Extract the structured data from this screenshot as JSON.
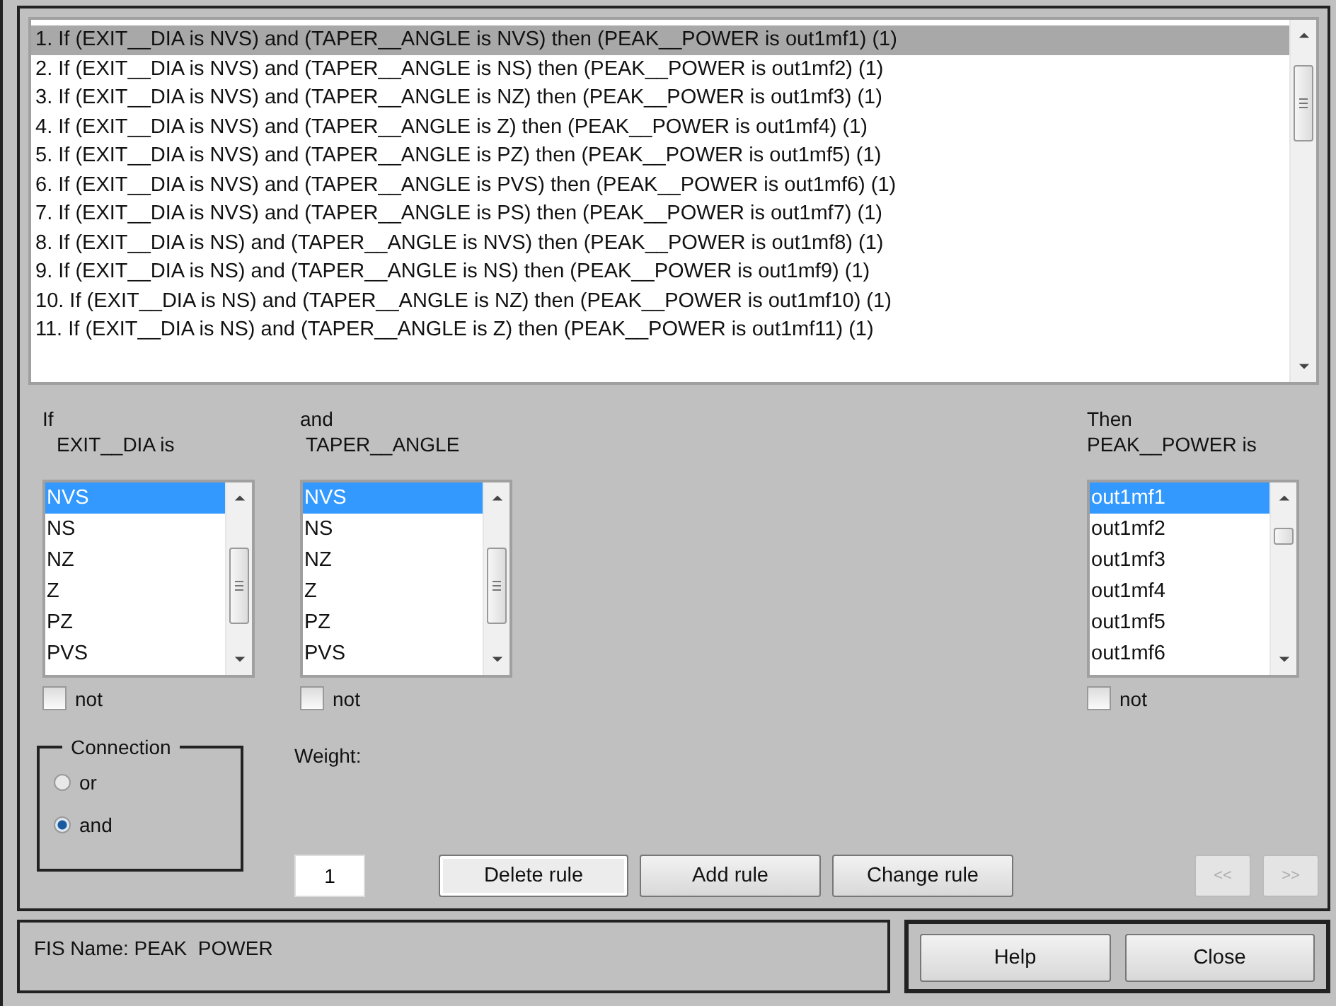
{
  "rules": [
    {
      "text": "1. If (EXIT__DIA is NVS) and (TAPER__ANGLE is NVS) then (PEAK__POWER is out1mf1) (1)",
      "selected": true
    },
    {
      "text": "2. If (EXIT__DIA is NVS) and (TAPER__ANGLE is NS) then (PEAK__POWER is out1mf2) (1)",
      "selected": false
    },
    {
      "text": "3. If (EXIT__DIA is NVS) and (TAPER__ANGLE is NZ) then (PEAK__POWER is out1mf3) (1)",
      "selected": false
    },
    {
      "text": "4. If (EXIT__DIA is NVS) and (TAPER__ANGLE is Z) then (PEAK__POWER is out1mf4) (1)",
      "selected": false
    },
    {
      "text": "5. If (EXIT__DIA is NVS) and (TAPER__ANGLE is PZ) then (PEAK__POWER is out1mf5) (1)",
      "selected": false
    },
    {
      "text": "6. If (EXIT__DIA is NVS) and (TAPER__ANGLE is PVS) then (PEAK__POWER is out1mf6) (1)",
      "selected": false
    },
    {
      "text": "7. If (EXIT__DIA is NVS) and (TAPER__ANGLE is PS) then (PEAK__POWER is out1mf7) (1)",
      "selected": false
    },
    {
      "text": "8. If (EXIT__DIA is NS) and (TAPER__ANGLE is NVS) then (PEAK__POWER is out1mf8) (1)",
      "selected": false
    },
    {
      "text": "9. If (EXIT__DIA is NS) and (TAPER__ANGLE is NS) then (PEAK__POWER is out1mf9) (1)",
      "selected": false
    },
    {
      "text": "10. If (EXIT__DIA is NS) and (TAPER__ANGLE is NZ) then (PEAK__POWER is out1mf10) (1)",
      "selected": false
    },
    {
      "text": "11. If (EXIT__DIA is NS) and (TAPER__ANGLE is Z) then (PEAK__POWER is out1mf11) (1)",
      "selected": false
    }
  ],
  "selectors": [
    {
      "caption": "If",
      "variable": "EXIT__DIA is",
      "items": [
        {
          "label": "NVS",
          "selected": true
        },
        {
          "label": "NS",
          "selected": false
        },
        {
          "label": "NZ",
          "selected": false
        },
        {
          "label": "Z",
          "selected": false
        },
        {
          "label": "PZ",
          "selected": false
        },
        {
          "label": "PVS",
          "selected": false
        }
      ],
      "not_label": "not",
      "not_checked": false
    },
    {
      "caption": "and",
      "variable": "TAPER__ANGLE",
      "items": [
        {
          "label": "NVS",
          "selected": true
        },
        {
          "label": "NS",
          "selected": false
        },
        {
          "label": "NZ",
          "selected": false
        },
        {
          "label": "Z",
          "selected": false
        },
        {
          "label": "PZ",
          "selected": false
        },
        {
          "label": "PVS",
          "selected": false
        }
      ],
      "not_label": "not",
      "not_checked": false
    },
    {
      "caption": "Then",
      "variable": "PEAK__POWER is",
      "items": [
        {
          "label": "out1mf1",
          "selected": true
        },
        {
          "label": "out1mf2",
          "selected": false
        },
        {
          "label": "out1mf3",
          "selected": false
        },
        {
          "label": "out1mf4",
          "selected": false
        },
        {
          "label": "out1mf5",
          "selected": false
        },
        {
          "label": "out1mf6",
          "selected": false
        }
      ],
      "not_label": "not",
      "not_checked": false
    }
  ],
  "connection": {
    "title": "Connection",
    "options": [
      {
        "label": "or",
        "selected": false
      },
      {
        "label": "and",
        "selected": true
      }
    ]
  },
  "weight": {
    "label": "Weight:",
    "value": "1"
  },
  "actions": [
    {
      "label": "Delete rule",
      "disabled": false
    },
    {
      "label": "Add rule",
      "disabled": false
    },
    {
      "label": "Change rule",
      "disabled": false
    }
  ],
  "nav": [
    {
      "label": "<<",
      "disabled": true
    },
    {
      "label": ">>",
      "disabled": true
    }
  ],
  "status": "FIS Name: PEAK  POWER",
  "footer_buttons": [
    {
      "label": "Help",
      "disabled": false
    },
    {
      "label": "Close",
      "disabled": false
    }
  ]
}
